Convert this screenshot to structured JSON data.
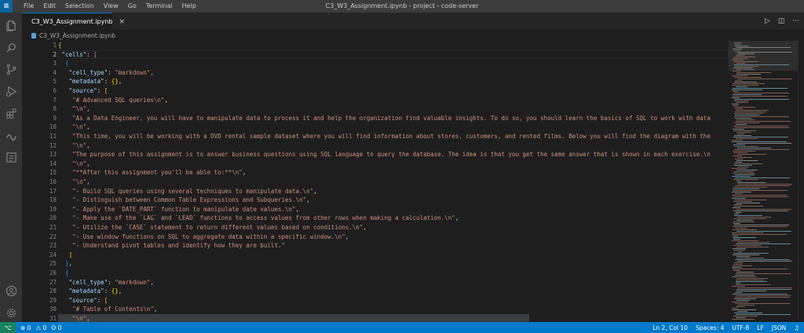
{
  "titlebar": {
    "logo": "≡",
    "menu": [
      "File",
      "Edit",
      "Selection",
      "View",
      "Go",
      "Terminal",
      "Help"
    ],
    "window_title": "C3_W3_Assignment.ipynb - project - code-server"
  },
  "activitybar": {
    "icons": [
      "files-icon",
      "search-icon",
      "source-control-icon",
      "run-debug-icon",
      "extensions-icon",
      "jupyter-icon",
      "notebook-outline-icon",
      "account-icon",
      "settings-gear-icon"
    ]
  },
  "tab": {
    "label": "C3_W3_Assignment.ipynb",
    "close": "×"
  },
  "editor_actions": {
    "run": "▷",
    "split": "◫",
    "more": "···"
  },
  "breadcrumb": {
    "file": "C3_W3_Assignment.ipynb"
  },
  "editor": {
    "line_numbers": [
      "1",
      "2",
      "3",
      "4",
      "5",
      "6",
      "7",
      "8",
      "9",
      "10",
      "11",
      "12",
      "13",
      "14",
      "15",
      "16",
      "17",
      "18",
      "19",
      "20",
      "21",
      "22",
      "23",
      "24",
      "25",
      "26",
      "27",
      "28",
      "29",
      "30",
      "31"
    ],
    "active_line": 2
  },
  "statusbar": {
    "remote_icon": "⌥",
    "errors": "⊗ 0",
    "warnings": "⚠ 0",
    "ports": "ʘ 0",
    "position": "Ln 2, Col 10",
    "spaces": "Spaces: 4",
    "encoding": "UTF-8",
    "eol": "LF",
    "language": "JSON",
    "bell": "♫"
  }
}
